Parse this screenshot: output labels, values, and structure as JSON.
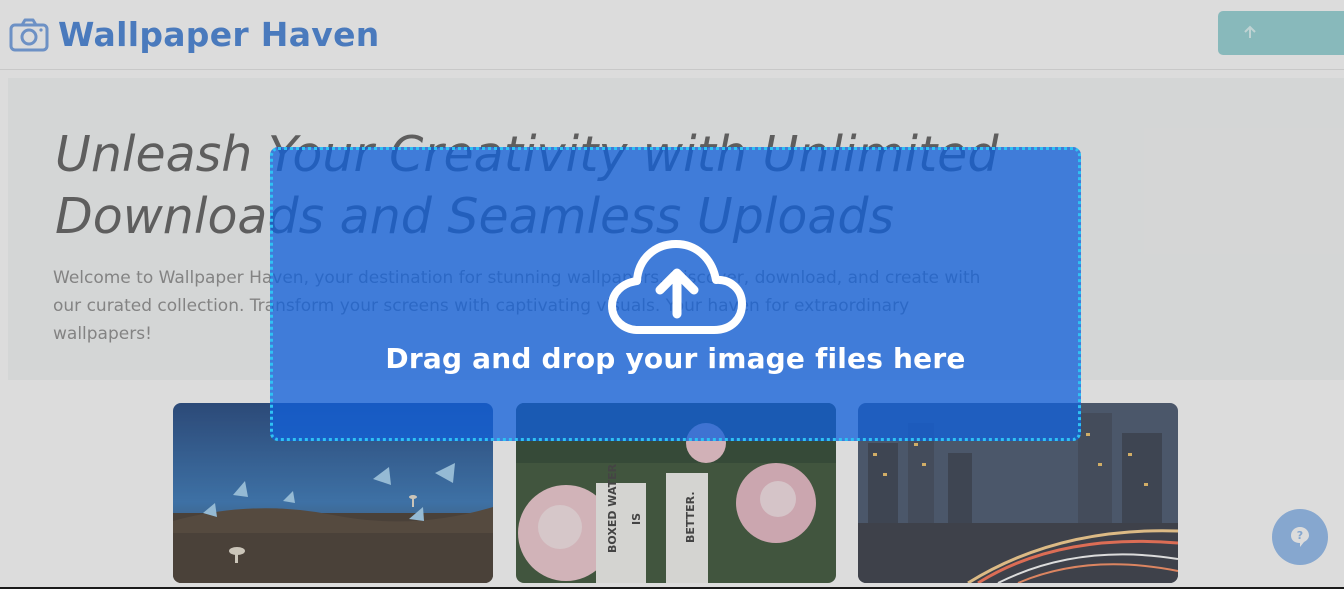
{
  "header": {
    "brand_icon": "camera-icon",
    "brand_name": "Wallpaper Haven",
    "action_icon": "upload-icon",
    "action_label": ""
  },
  "hero": {
    "title": "Unleash Your Creativity with Unlimited Downloads and Seamless Uploads",
    "text": "Welcome to Wallpaper Haven, your destination for stunning wallpapers. Discover, download, and create with our curated collection. Transform your screens with captivating visuals. Your haven for extraordinary wallpapers!"
  },
  "gallery": {
    "items": [
      {
        "name": "butterflies-mushrooms"
      },
      {
        "name": "flowers-boxed-water",
        "carton_texts": [
          "BOXED WATER",
          "IS",
          "BETTER."
        ]
      },
      {
        "name": "city-light-trails"
      }
    ]
  },
  "dropzone": {
    "icon": "cloud-upload-icon",
    "label": "Drag and drop your image files here"
  },
  "help": {
    "icon": "help-icon"
  },
  "colors": {
    "brand": "#3a7bd5",
    "dropzone_fill": "#1160da",
    "dropzone_border": "#2fc1f3",
    "header_button": "#8ed0d3",
    "help_button": "#8bb8ee"
  }
}
